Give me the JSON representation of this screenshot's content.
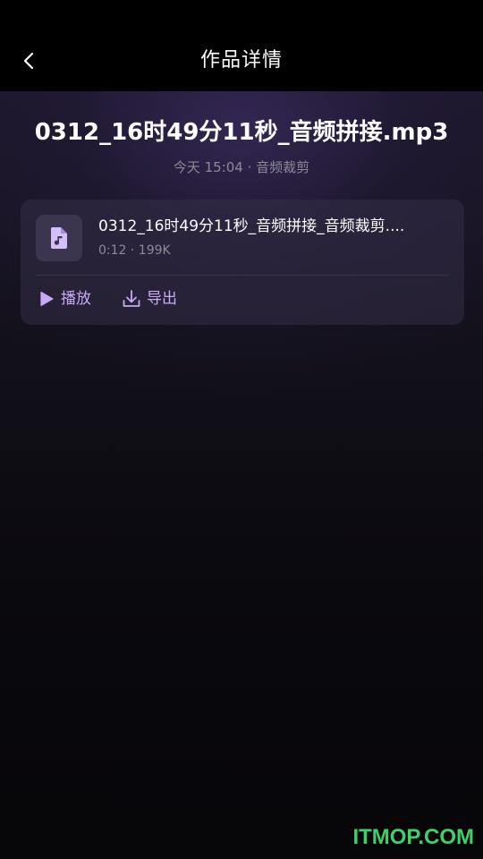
{
  "header": {
    "title": "作品详情"
  },
  "work": {
    "title": "0312_16时49分11秒_音频拼接.mp3",
    "meta": "今天 15:04 · 音频裁剪"
  },
  "file": {
    "name": "0312_16时49分11秒_音频拼接_音频裁剪....",
    "info": "0:12 · 199K"
  },
  "actions": {
    "play_label": "播放",
    "export_label": "导出"
  },
  "watermark": "ITMOP.COM",
  "colors": {
    "accent": "#c9a8f5",
    "icon_bg": "#3b3550",
    "watermark": "#3fd06a"
  },
  "icons": {
    "back": "chevron-left-icon",
    "file": "music-file-icon",
    "play": "play-icon",
    "export": "download-icon"
  }
}
